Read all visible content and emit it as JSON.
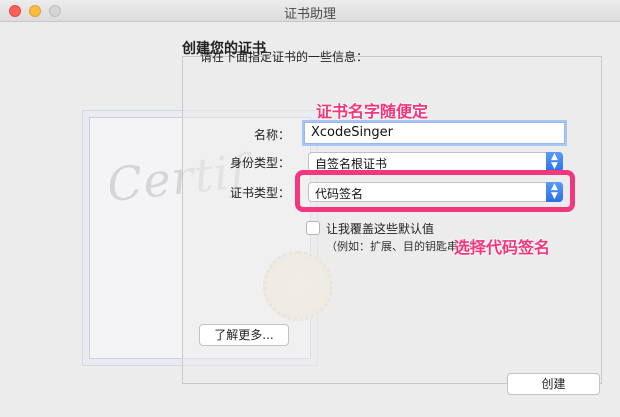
{
  "window": {
    "title": "证书助理"
  },
  "heading": "创建您的证书",
  "prompt": "请在下面指定证书的一些信息：",
  "watermark": {
    "text": "Certif"
  },
  "form": {
    "name_label": "名称：",
    "name_value": "XcodeSinger",
    "identity_label": "身份类型：",
    "identity_value": "自签名根证书",
    "cert_type_label": "证书类型：",
    "cert_type_value": "代码签名",
    "override_label": "让我覆盖这些默认值",
    "override_hint": "（例如：扩展、目的钥匙串等等）",
    "override_checked": false
  },
  "annotations": {
    "name_note": "证书名字随便定",
    "type_note": "选择代码签名",
    "color": "#f2377e"
  },
  "buttons": {
    "learn_more": "了解更多...",
    "create": "创建"
  },
  "icons": {
    "close": "close-dot-icon",
    "minimize": "minimize-dot-icon",
    "zoom": "zoom-dot-icon",
    "select_arrow": "updown-arrow-icon"
  }
}
